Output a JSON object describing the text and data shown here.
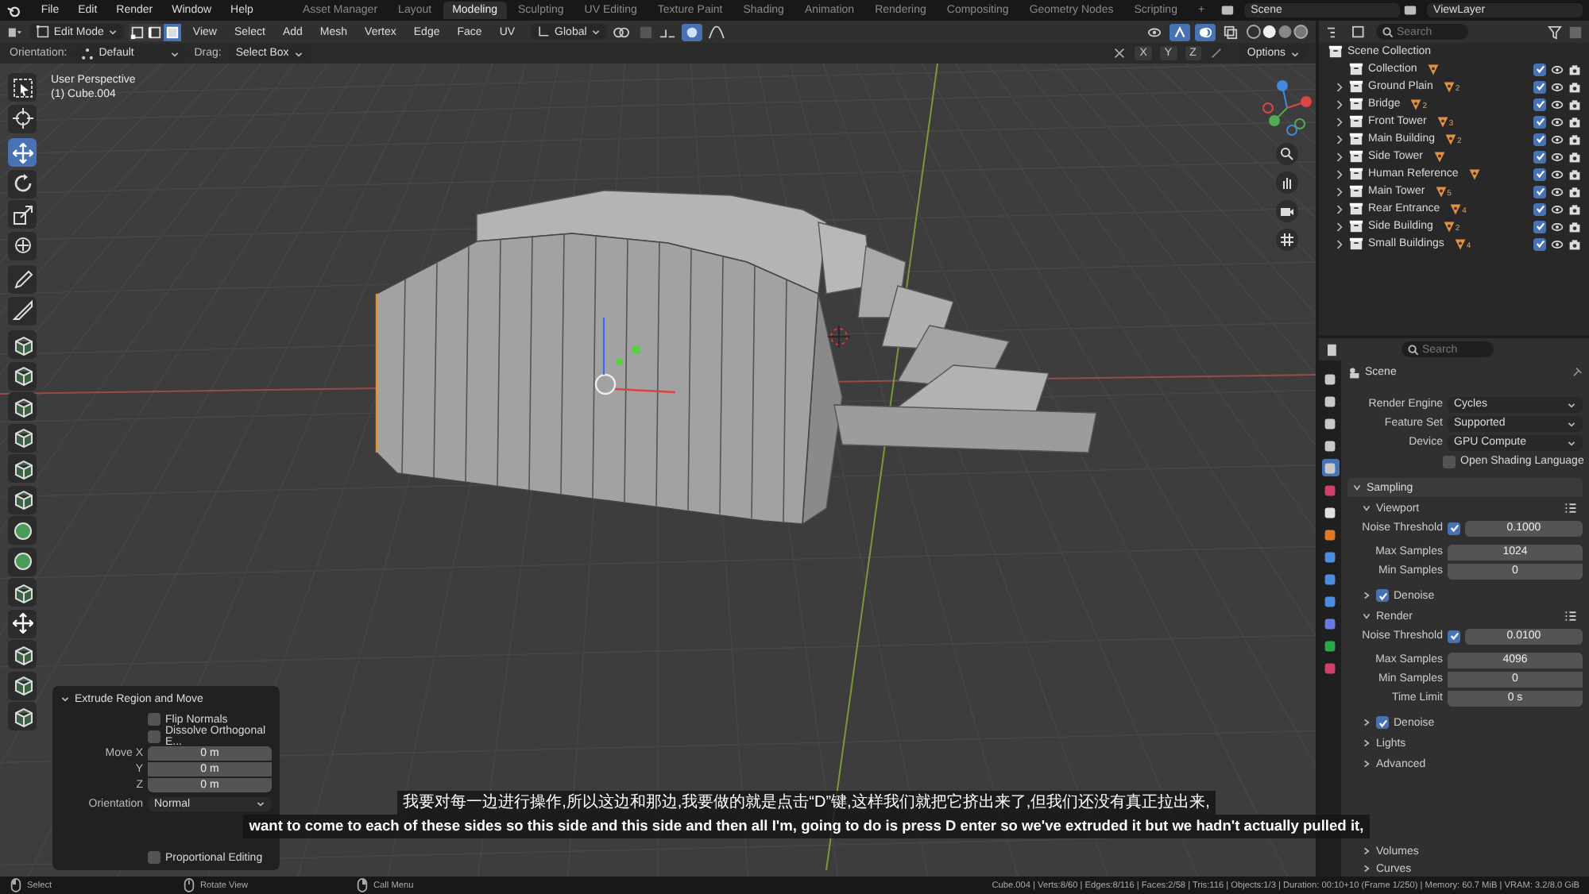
{
  "menubar": {
    "menus": [
      "File",
      "Edit",
      "Render",
      "Window",
      "Help"
    ],
    "workspaces": [
      {
        "label": "Asset Manager",
        "selected": false
      },
      {
        "label": "Layout",
        "selected": false
      },
      {
        "label": "Modeling",
        "selected": true
      },
      {
        "label": "Sculpting",
        "selected": false
      },
      {
        "label": "UV Editing",
        "selected": false
      },
      {
        "label": "Texture Paint",
        "selected": false
      },
      {
        "label": "Shading",
        "selected": false
      },
      {
        "label": "Animation",
        "selected": false
      },
      {
        "label": "Rendering",
        "selected": false
      },
      {
        "label": "Compositing",
        "selected": false
      },
      {
        "label": "Geometry Nodes",
        "selected": false
      },
      {
        "label": "Scripting",
        "selected": false
      }
    ],
    "add_tab": "+",
    "scene": "Scene",
    "view_layer": "ViewLayer"
  },
  "viewport_header": {
    "mode": "Edit Mode",
    "select_modes": [
      {
        "kind": "vertex",
        "selected": false
      },
      {
        "kind": "edge",
        "selected": false
      },
      {
        "kind": "face",
        "selected": true
      }
    ],
    "menus": [
      "View",
      "Select",
      "Add",
      "Mesh",
      "Vertex",
      "Edge",
      "Face",
      "UV"
    ],
    "orientation": "Global",
    "axes": [
      "X",
      "Y",
      "Z"
    ],
    "options": "Options"
  },
  "tool_settings": {
    "orientation_label": "Orientation:",
    "orientation": "Default",
    "drag_label": "Drag:",
    "drag": "Select Box"
  },
  "viewport": {
    "view_name": "User Perspective",
    "object_name": "(1) Cube.004"
  },
  "toolbar": [
    {
      "kind": "select",
      "selected": false
    },
    {
      "kind": "cursor",
      "selected": false
    },
    {
      "kind": "move",
      "selected": true
    },
    {
      "kind": "rotate",
      "selected": false
    },
    {
      "kind": "scale",
      "selected": false
    },
    {
      "kind": "transform",
      "selected": false
    },
    {
      "kind": "annotate",
      "selected": false
    },
    {
      "kind": "measure",
      "selected": false
    },
    {
      "kind": "cube",
      "selected": false
    },
    {
      "kind": "cube",
      "selected": false
    },
    {
      "kind": "cube",
      "selected": false
    },
    {
      "kind": "cube",
      "selected": false
    },
    {
      "kind": "cube",
      "selected": false
    },
    {
      "kind": "cube",
      "selected": false
    },
    {
      "kind": "sphere",
      "selected": false
    },
    {
      "kind": "sphere",
      "selected": false
    },
    {
      "kind": "cube",
      "selected": false
    },
    {
      "kind": "move",
      "selected": false
    },
    {
      "kind": "cube",
      "selected": false
    },
    {
      "kind": "cube",
      "selected": false
    },
    {
      "kind": "cube",
      "selected": false
    }
  ],
  "operator_panel": {
    "title": "Extrude Region and Move",
    "checks": [
      {
        "label": "Flip Normals",
        "checked": false
      },
      {
        "label": "Dissolve Orthogonal E...",
        "checked": false
      }
    ],
    "move": [
      {
        "label": "Move X",
        "value": "0 m"
      },
      {
        "label": "Y",
        "value": "0 m"
      },
      {
        "label": "Z",
        "value": "0 m"
      }
    ],
    "orientation_label": "Orientation",
    "orientation": "Normal",
    "proportional": {
      "label": "Proportional Editing",
      "checked": false
    }
  },
  "outliner": {
    "search_placeholder": "Search",
    "root": "Scene Collection",
    "items": [
      {
        "name": "Collection",
        "expandable": false,
        "checked": true
      },
      {
        "name": "Ground Plain",
        "expandable": true,
        "count": "2",
        "checked": true
      },
      {
        "name": "Bridge",
        "expandable": true,
        "count": "2",
        "checked": true
      },
      {
        "name": "Front Tower",
        "expandable": true,
        "count": "3",
        "checked": true
      },
      {
        "name": "Main Building",
        "expandable": true,
        "count": "2",
        "checked": true
      },
      {
        "name": "Side Tower",
        "expandable": true,
        "checked": true
      },
      {
        "name": "Human Reference",
        "expandable": true,
        "checked": true
      },
      {
        "name": "Main Tower",
        "expandable": true,
        "count": "5",
        "checked": true
      },
      {
        "name": "Rear Entrance",
        "expandable": true,
        "count": "4",
        "checked": true
      },
      {
        "name": "Side Building",
        "expandable": true,
        "count": "2",
        "checked": true
      },
      {
        "name": "Small Buildings",
        "expandable": true,
        "count": "4",
        "checked": true
      }
    ]
  },
  "properties": {
    "search_placeholder": "Search",
    "context": "Scene",
    "tabs": [
      {
        "color": "#c8c8c8",
        "selected": false
      },
      {
        "color": "#c8c8c8",
        "selected": false
      },
      {
        "color": "#c8c8c8",
        "selected": false
      },
      {
        "color": "#c8c8c8",
        "selected": false
      },
      {
        "color": "#c8c8c8",
        "selected": true
      },
      {
        "color": "#d0406a",
        "selected": false
      },
      {
        "color": "#e0e0e0",
        "selected": false
      },
      {
        "color": "#e07a28",
        "selected": false
      },
      {
        "color": "#4a8ce0",
        "selected": false
      },
      {
        "color": "#4a8ce0",
        "selected": false
      },
      {
        "color": "#4a8ce0",
        "selected": false
      },
      {
        "color": "#6a7ae0",
        "selected": false
      },
      {
        "color": "#2aa84a",
        "selected": false
      },
      {
        "color": "#d0406a",
        "selected": false
      }
    ],
    "fields": [
      {
        "label": "Render Engine",
        "value": "Cycles"
      },
      {
        "label": "Feature Set",
        "value": "Supported"
      },
      {
        "label": "Device",
        "value": "GPU Compute"
      }
    ],
    "osl": {
      "label": "Open Shading Language",
      "checked": false
    },
    "panels": [
      {
        "kind": "section",
        "label": "Sampling",
        "expanded": true
      },
      {
        "kind": "subsection",
        "label": "Viewport",
        "expanded": true
      },
      {
        "kind": "threshold",
        "label": "Noise Threshold",
        "checked": true,
        "value": "0.1000"
      },
      {
        "kind": "value",
        "label": "Max Samples",
        "value": "1024"
      },
      {
        "kind": "value",
        "label": "Min Samples",
        "value": "0"
      },
      {
        "kind": "check",
        "label": "Denoise",
        "checked": true
      },
      {
        "kind": "subsection",
        "label": "Render",
        "expanded": true
      },
      {
        "kind": "threshold",
        "label": "Noise Threshold",
        "checked": true,
        "value": "0.0100"
      },
      {
        "kind": "value",
        "label": "Max Samples",
        "value": "4096"
      },
      {
        "kind": "value",
        "label": "Min Samples",
        "value": "0"
      },
      {
        "kind": "value",
        "label": "Time Limit",
        "value": "0 s"
      },
      {
        "kind": "check",
        "label": "Denoise",
        "checked": true
      },
      {
        "kind": "subsection",
        "label": "Lights",
        "expanded": false
      },
      {
        "kind": "subsection",
        "label": "Advanced",
        "expanded": false
      },
      {
        "kind": "gap"
      },
      {
        "kind": "subsection",
        "label": "Volumes",
        "expanded": false
      },
      {
        "kind": "subsection",
        "label": "Curves",
        "expanded": false
      }
    ]
  },
  "subtitles": [
    "我要对每一边进行操作,所以这边和那边,我要做的就是点击“D”键,这样我们就把它挤出来了,但我们还没有真正拉出来,",
    "want to come to each of these sides so this side and this side and then all I'm, going to do is press D enter so we've extruded it but we hadn't actually pulled it,"
  ],
  "status_bar": {
    "hints": [
      {
        "kind": "mouse-left",
        "label": "Select"
      },
      {
        "kind": "mouse-middle",
        "label": "Rotate View"
      },
      {
        "kind": "mouse-right",
        "label": "Call Menu"
      }
    ],
    "stats": "Cube.004 | Verts:8/60 | Edges:8/116 | Faces:2/58 | Tris:116 | Objects:1/3 | Duration: 00:10+10 (Frame 1/250) | Memory: 60.7 MiB | VRAM: 3.2/8.0 GiB"
  }
}
